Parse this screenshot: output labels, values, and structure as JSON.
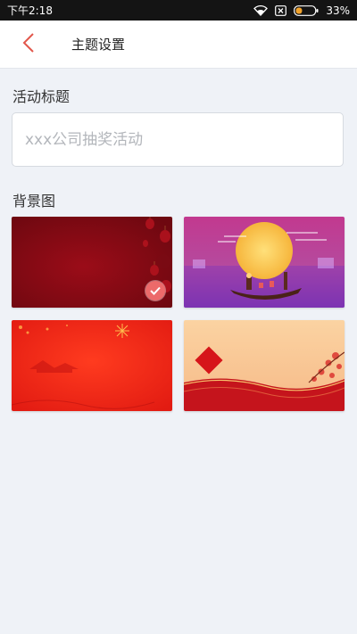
{
  "status_bar": {
    "time": "下午2:18",
    "battery_percent": "33%",
    "battery_level": 0.33,
    "icons": [
      "wifi-icon",
      "sim-blocked-icon",
      "battery-icon"
    ]
  },
  "nav": {
    "back_icon": "chevron-left-icon",
    "title": "主题设置",
    "accent": "#e2574c"
  },
  "activity_title": {
    "label": "活动标题",
    "value": "",
    "placeholder": "xxx公司抽奖活动"
  },
  "background": {
    "label": "背景图",
    "selected_index": 0,
    "options": [
      {
        "theme": "dark-red-lanterns",
        "selected": true
      },
      {
        "theme": "purple-moon-boat",
        "selected": false
      },
      {
        "theme": "bright-red-fireworks",
        "selected": false
      },
      {
        "theme": "peach-diamond-blossom",
        "selected": false
      }
    ],
    "check_icon": "checkmark-icon",
    "check_color": "#ec6a6a"
  }
}
